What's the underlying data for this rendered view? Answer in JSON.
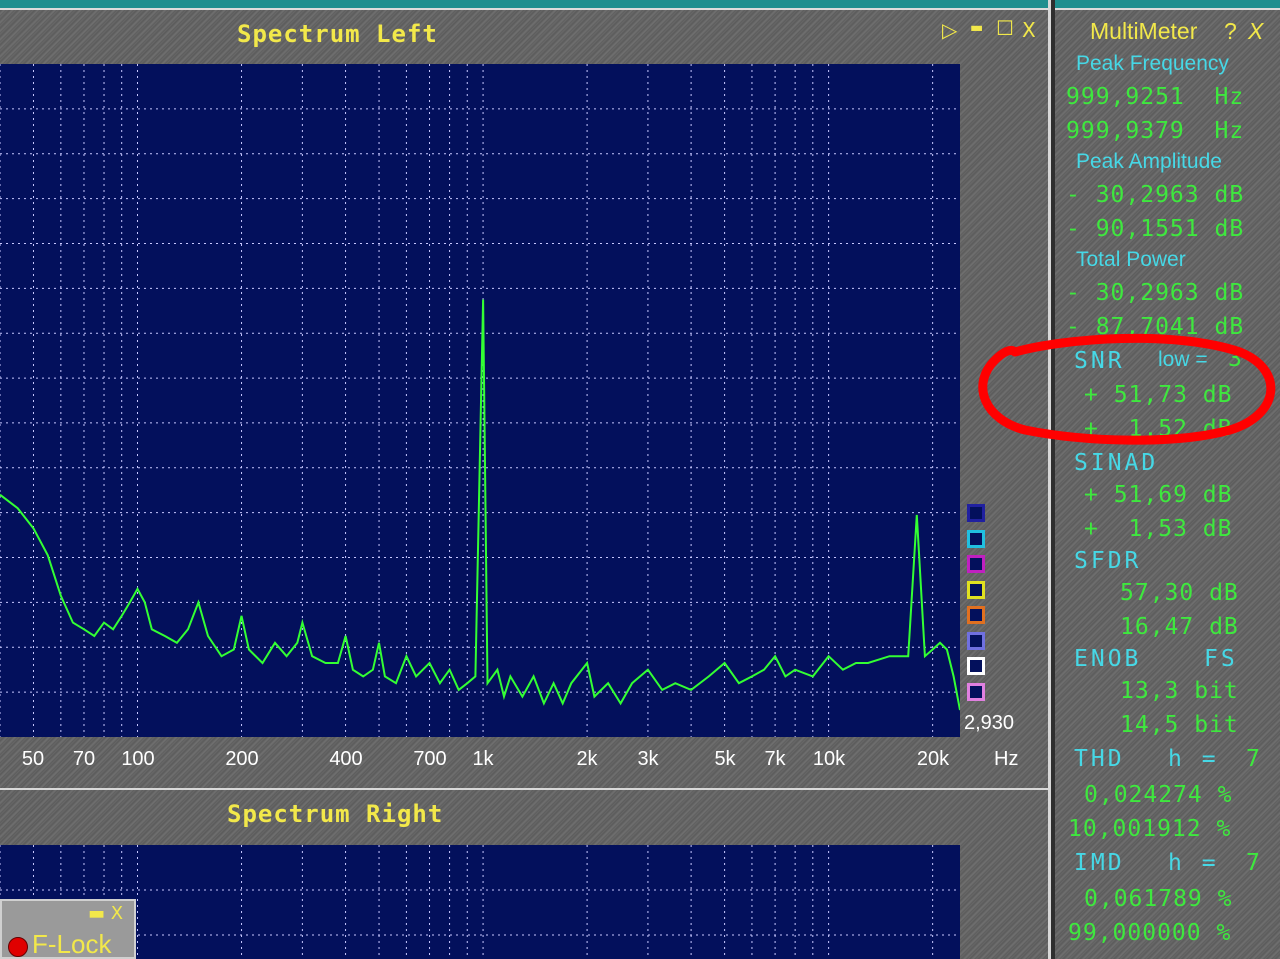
{
  "left_panel": {
    "title": "Spectrum Left",
    "window_controls": {
      "play": "▷",
      "minimize": "▬",
      "maximize": "☐",
      "close": "X"
    },
    "value_label": "2,930",
    "unit_label": "Hz",
    "legend_colors": [
      "#2020a0",
      "#20c0e0",
      "#c020c0",
      "#e0e020",
      "#e07020",
      "#7070e0",
      "#ffffff",
      "#e080e0"
    ]
  },
  "right_panel": {
    "title": "Spectrum Right"
  },
  "flock": {
    "controls": "▬ X",
    "label": "F-Lock"
  },
  "multimeter": {
    "title": "MultiMeter",
    "help": "?",
    "close": "X",
    "peak_frequency": {
      "label": "Peak Frequency",
      "v1": "999,9251  Hz",
      "v2": "999,9379  Hz"
    },
    "peak_amplitude": {
      "label": "Peak Amplitude",
      "v1": "- 30,2963 dB",
      "v2": "- 90,1551 dB"
    },
    "total_power": {
      "label": "Total Power",
      "v1": "- 30,2963 dB",
      "v2": "- 87,7041 dB"
    },
    "snr": {
      "label": "SNR",
      "low_label": "low =",
      "low_value": "3",
      "v1": "+ 51,73 dB",
      "v2": "+  1,52 dB"
    },
    "sinad": {
      "label": "SINAD",
      "v1": "+ 51,69 dB",
      "v2": "+  1,53 dB"
    },
    "sfdr": {
      "label": "SFDR",
      "v1": "57,30 dB",
      "v2": "16,47 dB"
    },
    "enob": {
      "label": "ENOB",
      "mode": "FS",
      "v1": "13,3 bit",
      "v2": "14,5 bit"
    },
    "thd": {
      "label": "THD",
      "h_label": "h =",
      "h_value": "7",
      "v1": "0,024274 %",
      "v2": "10,001912 %"
    },
    "imd": {
      "label": "IMD",
      "h_label": "h =",
      "h_value": "7",
      "v1": "0,061789 %",
      "v2": "99,000000 %"
    }
  },
  "chart_data": {
    "type": "line",
    "title": "Spectrum Left",
    "xlabel": "Hz",
    "ylabel": "",
    "x_scale": "log",
    "xlim": [
      40,
      24000
    ],
    "tick_labels": [
      "50",
      "70",
      "100",
      "200",
      "400",
      "700",
      "1k",
      "2k",
      "3k",
      "5k",
      "7k",
      "10k",
      "20k"
    ],
    "tick_values": [
      50,
      70,
      100,
      200,
      400,
      700,
      1000,
      2000,
      3000,
      5000,
      7000,
      10000,
      20000
    ],
    "grid": true,
    "series": [
      {
        "color": "#33ff33",
        "points": [
          [
            40,
            0.64
          ],
          [
            45,
            0.66
          ],
          [
            50,
            0.69
          ],
          [
            55,
            0.73
          ],
          [
            60,
            0.79
          ],
          [
            65,
            0.83
          ],
          [
            70,
            0.84
          ],
          [
            75,
            0.85
          ],
          [
            80,
            0.83
          ],
          [
            85,
            0.84
          ],
          [
            90,
            0.82
          ],
          [
            95,
            0.8
          ],
          [
            100,
            0.78
          ],
          [
            105,
            0.8
          ],
          [
            110,
            0.84
          ],
          [
            120,
            0.85
          ],
          [
            130,
            0.86
          ],
          [
            140,
            0.84
          ],
          [
            150,
            0.8
          ],
          [
            160,
            0.85
          ],
          [
            175,
            0.88
          ],
          [
            190,
            0.87
          ],
          [
            200,
            0.82
          ],
          [
            210,
            0.87
          ],
          [
            230,
            0.89
          ],
          [
            250,
            0.86
          ],
          [
            270,
            0.88
          ],
          [
            290,
            0.86
          ],
          [
            300,
            0.83
          ],
          [
            320,
            0.88
          ],
          [
            350,
            0.89
          ],
          [
            380,
            0.89
          ],
          [
            400,
            0.85
          ],
          [
            420,
            0.9
          ],
          [
            450,
            0.91
          ],
          [
            480,
            0.9
          ],
          [
            500,
            0.86
          ],
          [
            520,
            0.91
          ],
          [
            560,
            0.92
          ],
          [
            600,
            0.88
          ],
          [
            640,
            0.91
          ],
          [
            700,
            0.89
          ],
          [
            750,
            0.92
          ],
          [
            800,
            0.9
          ],
          [
            850,
            0.93
          ],
          [
            900,
            0.92
          ],
          [
            950,
            0.91
          ],
          [
            1000,
            0.35
          ],
          [
            1030,
            0.92
          ],
          [
            1100,
            0.9
          ],
          [
            1150,
            0.94
          ],
          [
            1200,
            0.91
          ],
          [
            1300,
            0.94
          ],
          [
            1400,
            0.91
          ],
          [
            1500,
            0.95
          ],
          [
            1600,
            0.92
          ],
          [
            1700,
            0.95
          ],
          [
            1800,
            0.92
          ],
          [
            2000,
            0.89
          ],
          [
            2100,
            0.94
          ],
          [
            2300,
            0.92
          ],
          [
            2500,
            0.95
          ],
          [
            2700,
            0.92
          ],
          [
            3000,
            0.9
          ],
          [
            3300,
            0.93
          ],
          [
            3600,
            0.92
          ],
          [
            4000,
            0.93
          ],
          [
            4500,
            0.91
          ],
          [
            5000,
            0.89
          ],
          [
            5500,
            0.92
          ],
          [
            6000,
            0.91
          ],
          [
            6500,
            0.9
          ],
          [
            7000,
            0.88
          ],
          [
            7500,
            0.91
          ],
          [
            8000,
            0.9
          ],
          [
            9000,
            0.91
          ],
          [
            10000,
            0.88
          ],
          [
            11000,
            0.9
          ],
          [
            12000,
            0.89
          ],
          [
            13000,
            0.89
          ],
          [
            15000,
            0.88
          ],
          [
            17000,
            0.88
          ],
          [
            18000,
            0.67
          ],
          [
            19000,
            0.88
          ],
          [
            20000,
            0.87
          ],
          [
            21000,
            0.86
          ],
          [
            22000,
            0.87
          ],
          [
            23000,
            0.91
          ],
          [
            24000,
            0.96
          ]
        ]
      }
    ]
  }
}
